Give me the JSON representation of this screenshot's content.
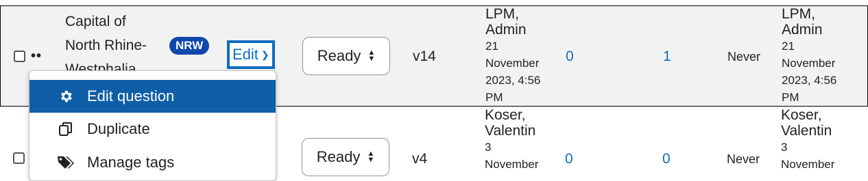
{
  "rows": [
    {
      "question_name_lines": [
        "Capital of",
        "North Rhine-",
        "Westphalia"
      ],
      "tag_badge": "NRW",
      "edit_label": "Edit",
      "status": "Ready",
      "version": "v14",
      "created_by_lines": [
        "LPM,",
        "Admin"
      ],
      "created_date_lines": [
        "21",
        "November",
        "2023, 4:56",
        "PM"
      ],
      "usage_count": "0",
      "comments_count": "1",
      "last_used": "Never",
      "modified_by_lines": [
        "LPM,",
        "Admin"
      ],
      "modified_date_lines": [
        "21",
        "November",
        "2023, 4:56",
        "PM"
      ]
    },
    {
      "status": "Ready",
      "version": "v4",
      "created_by_lines": [
        "Koser,",
        "Valentin"
      ],
      "created_date_lines": [
        "3",
        "November"
      ],
      "usage_count": "0",
      "comments_count": "0",
      "last_used": "Never",
      "modified_by_lines": [
        "Koser,",
        "Valentin"
      ],
      "modified_date_lines": [
        "3",
        "November"
      ]
    }
  ],
  "edit_menu": {
    "items": [
      {
        "label": "Edit question",
        "icon": "gear-icon",
        "active": true
      },
      {
        "label": "Duplicate",
        "icon": "duplicate-icon",
        "active": false
      },
      {
        "label": "Manage tags",
        "icon": "tags-icon",
        "active": false
      }
    ]
  },
  "colors": {
    "link_blue": "#0f6cbf",
    "badge_blue": "#0f47ad",
    "menu_active": "#0f5ea8",
    "row_highlight": "#f2f2f2"
  }
}
